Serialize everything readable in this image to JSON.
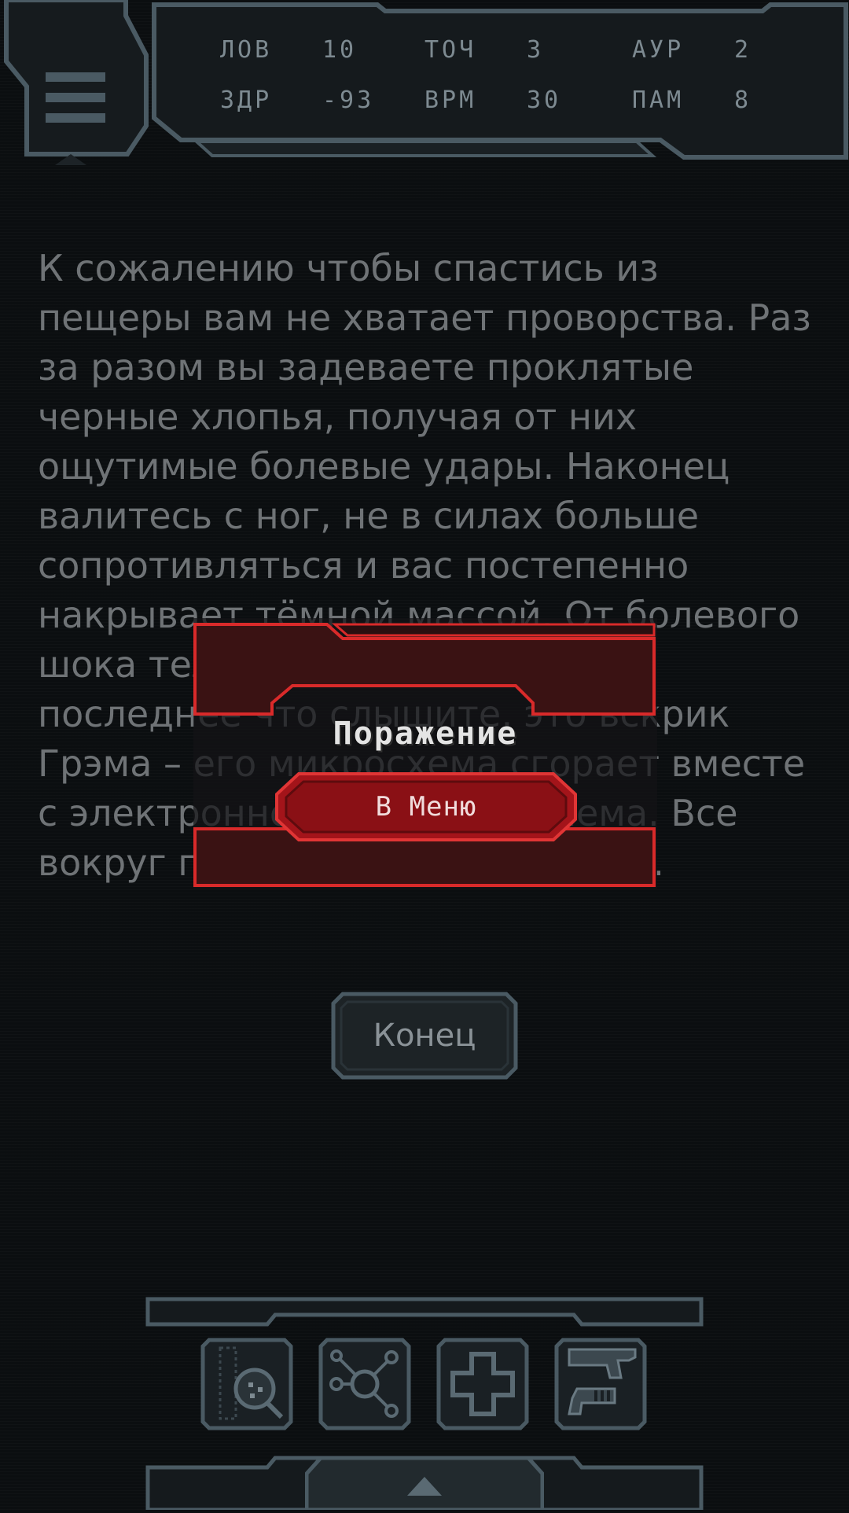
{
  "hud": {
    "stats": [
      {
        "label": "ЛОВ",
        "value": "10"
      },
      {
        "label": "ТОЧ",
        "value": "3"
      },
      {
        "label": "АУР",
        "value": "2"
      },
      {
        "label": "ЗДР",
        "value": "-93"
      },
      {
        "label": "ВРМ",
        "value": "30"
      },
      {
        "label": "ПАМ",
        "value": "8"
      }
    ]
  },
  "story": {
    "text": "К сожалению чтобы спастись из пещеры вам не хватает проворства. Раз за разом вы задеваете проклятые черные хлопья, получая от них ощутимые болевые удары. Наконец валитесь с ног, не в силах больше сопротивляться и вас постепенно накрывает тёмной массой. От болевого шока тело сводит судорогой, и последнее что слышите, это вскрик Грэма – его микросхема сгорает вместе с электронной начинкой шлема. Все вокруг погружается в темноту..."
  },
  "end_button": {
    "label": "Конец"
  },
  "dialog": {
    "title": "Поражение",
    "menu_button": "В Меню"
  },
  "toolbar": {
    "icons": [
      "scan-icon",
      "network-icon",
      "medkit-icon",
      "weapons-icon"
    ],
    "expand_icon": "chevron-up-icon"
  },
  "colors": {
    "background": "#0b0e10",
    "frame": "#4a5a63",
    "accent_red": "#d92a2a"
  }
}
